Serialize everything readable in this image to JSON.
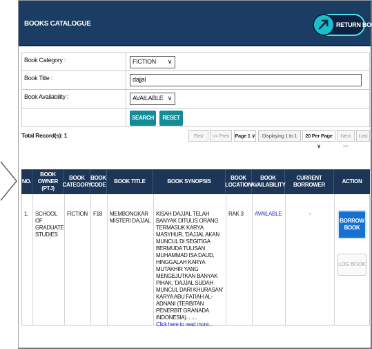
{
  "header": {
    "title": "BOOKS CATALOGUE",
    "return_label": "RETURN BOOK"
  },
  "form": {
    "category_label": "Book Category :",
    "category_value": "FICTION",
    "title_label": "Book Title :",
    "title_value": "dajjal",
    "availability_label": "Book Availability :",
    "availability_value": "AVAILABLE",
    "search_label": "SEARCH",
    "reset_label": "RESET"
  },
  "pager": {
    "total": "Total Record(s): 1",
    "first": "First",
    "prev": "<< Prev",
    "page": "Page 1",
    "displaying": "Displaying 1 to 1",
    "per_page": "20 Per Page",
    "next": "Next >>",
    "last": "Last"
  },
  "table": {
    "headers": [
      "NO.",
      "BOOK OWNER (PTJ)",
      "BOOK CATEGORY",
      "BOOK CODE",
      "BOOK TITLE",
      "BOOK SYNOPSIS",
      "BOOK LOCATION",
      "BOOK AVAILABILITY",
      "CURRENT BORROWER",
      "ACTION"
    ],
    "rows": [
      {
        "no": "1.",
        "owner": "SCHOOL OF GRADUATE STUDIES",
        "category": "FICTION",
        "code": "F18",
        "title": "MEMBONGKAR MISTERI DAJJAL",
        "synopsis": "KISAH DAJJAL TELAH BANYAK DITULIS ORANG TERMASUK KARYA MASYHUR, 'DAJJAL AKAN MUNCUL DI SEGITIGA BERMUDA TULISAN MUHAMMAD ISA DAUD, HINGGALAH KARYA MUTAKHIR YANG MENGEJUTKAN BANYAK PIHAK, 'DAJJAL SUDAH MUNCUL DARI KHURASAN' KARYA ABU FATIAH AL-ADNANI (TERBITAN PENERBIT GRANADA INDONESIA)........",
        "read_more": "Click here to read more...",
        "location": "RAK 3",
        "availability": "AVAILABLE",
        "borrower": "-",
        "borrow_label": "BORROW BOOK",
        "log_label": "LOG BOOK"
      }
    ]
  },
  "colors": {
    "header_bg": "#1b3d63",
    "teal": "#128d97",
    "borrow_blue": "#1671d3",
    "link_blue": "#1f2fcf"
  },
  "icons": [
    "left-arrow-icon",
    "return-book-icon",
    "chevron-down-icon"
  ]
}
